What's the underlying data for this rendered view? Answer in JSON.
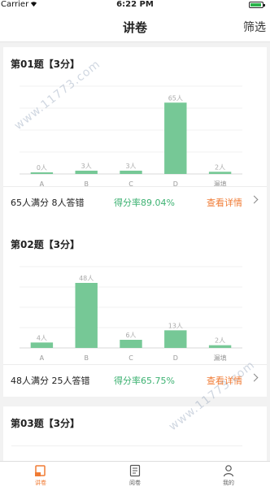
{
  "status_bar": {
    "carrier": "Carrier",
    "time": "6:22 PM"
  },
  "nav": {
    "title": "讲卷",
    "filter_label": "筛选"
  },
  "colors": {
    "bar": "#76c896",
    "accent": "#f07b34",
    "rate": "#3db272"
  },
  "questions": [
    {
      "title": "第01题【3分】",
      "stats": "65人满分 8人答错",
      "score_rate": "得分率89.04%",
      "details_label": "查看详情",
      "chart_data": {
        "type": "bar",
        "categories": [
          "A",
          "B",
          "C",
          "D",
          "漏填"
        ],
        "values": [
          0,
          3,
          3,
          65,
          2
        ],
        "data_labels": [
          "0人",
          "3人",
          "3人",
          "65人",
          "2人"
        ],
        "ylim": [
          0,
          80
        ]
      }
    },
    {
      "title": "第02题【3分】",
      "stats": "48人满分 25人答错",
      "score_rate": "得分率65.75%",
      "details_label": "查看详情",
      "chart_data": {
        "type": "bar",
        "categories": [
          "A",
          "B",
          "C",
          "D",
          "漏填"
        ],
        "values": [
          4,
          48,
          6,
          13,
          2
        ],
        "data_labels": [
          "4人",
          "48人",
          "6人",
          "13人",
          "2人"
        ],
        "ylim": [
          0,
          60
        ]
      }
    },
    {
      "title": "第03题【3分】"
    }
  ],
  "tabs": [
    {
      "label": "讲卷",
      "icon": "lecture-icon",
      "active": true
    },
    {
      "label": "阅卷",
      "icon": "document-icon",
      "active": false
    },
    {
      "label": "我的",
      "icon": "person-icon",
      "active": false
    }
  ],
  "watermark": "www.11773.com"
}
